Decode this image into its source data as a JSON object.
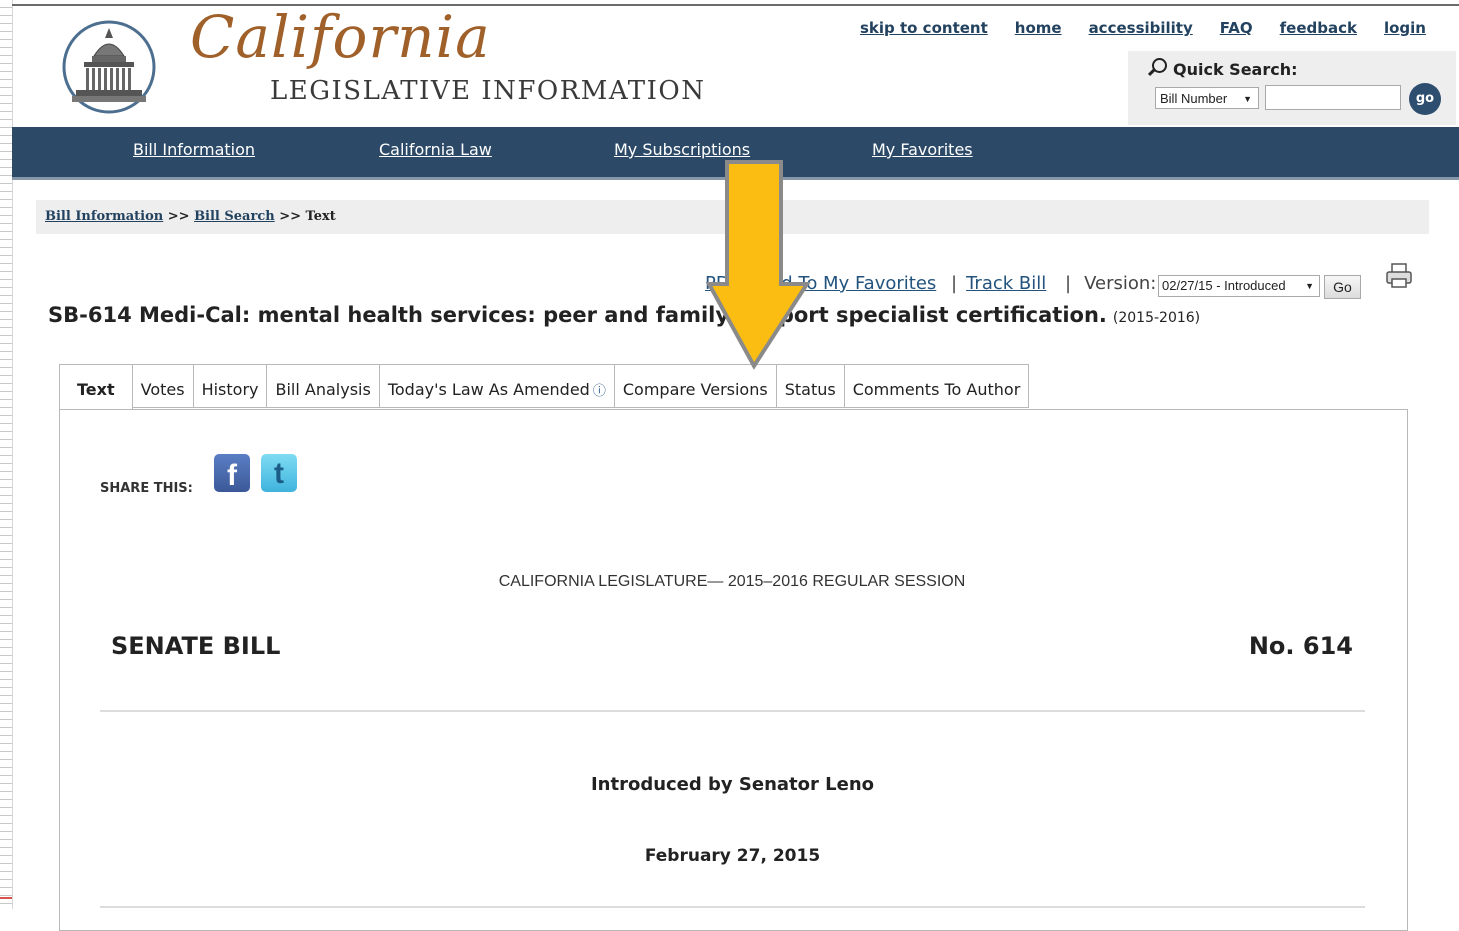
{
  "header": {
    "logo_script": "California",
    "logo_subtitle": "LEGISLATIVE INFORMATION",
    "utility_links": [
      "skip to content",
      "home",
      "accessibility",
      "FAQ",
      "feedback",
      "login"
    ]
  },
  "quick_search": {
    "title": "Quick Search:",
    "select_value": "Bill Number",
    "input_value": "",
    "go_label": "go"
  },
  "nav": {
    "items": [
      "Bill Information",
      "California Law",
      "My Subscriptions",
      "My Favorites"
    ]
  },
  "breadcrumb": {
    "link1": "Bill Information",
    "sep1": " >> ",
    "link2": "Bill Search",
    "sep2": " >> ",
    "current": "Text"
  },
  "actions": {
    "pdf": "PDF",
    "add_favorites": "Add To My Favorites",
    "track_bill": "Track Bill",
    "sep": "|",
    "version_label": "Version:",
    "version_value": "02/27/15 - Introduced",
    "go_label": "Go"
  },
  "bill": {
    "title": "SB-614 Medi-Cal: mental health services: peer and family support specialist certification.",
    "session": "(2015-2016)"
  },
  "tabs": [
    "Text",
    "Votes",
    "History",
    "Bill Analysis",
    "Today's Law As Amended",
    "Compare Versions",
    "Status",
    "Comments To Author"
  ],
  "tab_info_icon": "ⓘ",
  "share": {
    "label": "SHARE THIS:"
  },
  "document": {
    "session_line": "CALIFORNIA LEGISLATURE— 2015–2016 REGULAR SESSION",
    "bill_type": "SENATE BILL",
    "bill_number": "No. 614",
    "introduced_by": "Introduced by Senator Leno",
    "date": "February 27, 2015"
  },
  "colors": {
    "nav_bg": "#2c4a68",
    "arrow": "#fbbd12",
    "link": "#23537d"
  },
  "icons": [
    "search-icon",
    "printer-icon",
    "facebook-icon",
    "twitter-icon",
    "capitol-seal-icon",
    "info-icon",
    "arrow-annotation"
  ]
}
